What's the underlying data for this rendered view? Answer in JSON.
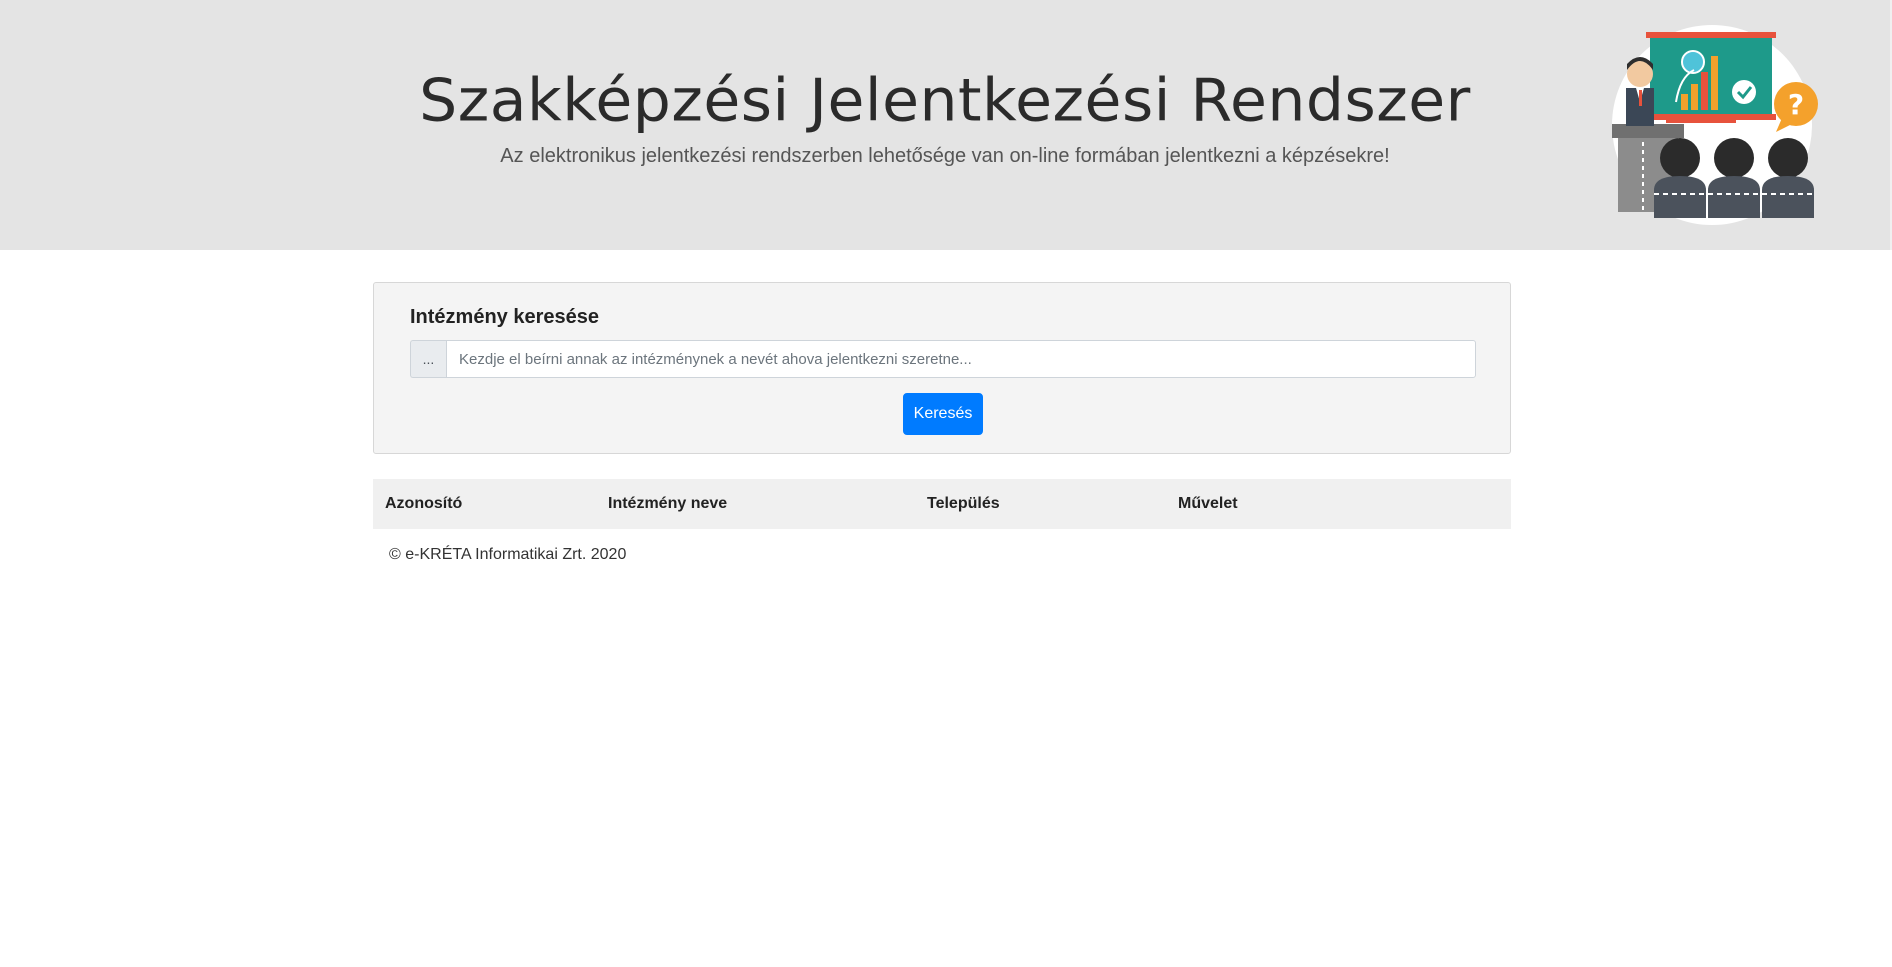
{
  "header": {
    "title": "Szakképzési Jelentkezési Rendszer",
    "subtitle": "Az elektronikus jelentkezési rendszerben lehetősége van on-line formában jelentkezni a képzésekre!"
  },
  "search": {
    "card_title": "Intézmény keresése",
    "prepend_label": "...",
    "input_value": "",
    "placeholder": "Kezdje el beírni annak az intézménynek a nevét ahova jelentkezni szeretne...",
    "button_label": "Keresés"
  },
  "table": {
    "columns": [
      "Azonosító",
      "Intézmény neve",
      "Település",
      "Művelet"
    ],
    "rows": []
  },
  "footer": {
    "copyright": "© e-KRÉTA Informatikai Zrt. 2020"
  },
  "colors": {
    "primary": "#007bff",
    "header_bg": "#e4e4e4",
    "card_bg": "#f4f4f4"
  },
  "icons": {
    "hero": "presentation-illustration"
  }
}
